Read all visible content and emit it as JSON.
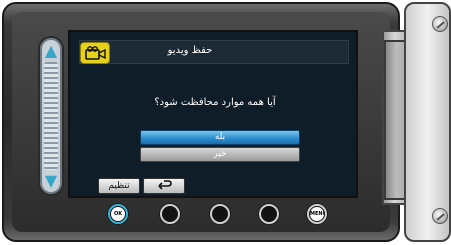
{
  "screen": {
    "title": "حفظ ویدیو",
    "question": "آیا همه موارد محافظت شود؟",
    "options": [
      {
        "label": "بله",
        "selected": true
      },
      {
        "label": "خیر",
        "selected": false
      }
    ],
    "soft_buttons": {
      "settings_label": "تنظیم",
      "back_icon": "return-arrow-icon"
    },
    "mode_icon": "video-camera-icon"
  },
  "hardware_buttons": [
    {
      "name": "ok-button",
      "label": "OK"
    },
    {
      "name": "blank-button-1",
      "label": ""
    },
    {
      "name": "blank-button-2",
      "label": ""
    },
    {
      "name": "blank-button-3",
      "label": ""
    },
    {
      "name": "menu-button",
      "label": "MENU"
    }
  ],
  "colors": {
    "accent_yellow": "#e6d21a",
    "selection_blue": "#2d8fd0",
    "slider_arrows": "#38a6c8"
  }
}
